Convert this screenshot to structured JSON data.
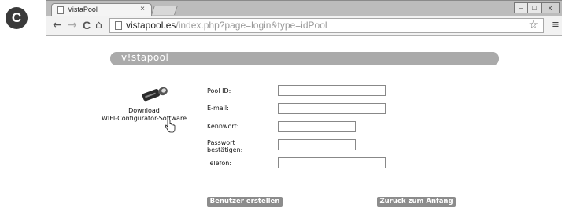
{
  "figure_label": "C",
  "browser": {
    "tab_title": "VistaPool",
    "tab_close": "×",
    "window_controls": [
      "–",
      "□",
      "x"
    ],
    "back": "←",
    "forward": "→",
    "reload": "C",
    "home": "⌂",
    "url_host": "vistapool.es",
    "url_path": "/index.php?page=login&type=idPool",
    "star": "☆",
    "menu": "≡"
  },
  "page": {
    "logo_text": "v!stapool",
    "download_label_line1": "Download",
    "download_label_line2": "WIFI-Configurator-Software",
    "form": {
      "pool_id_label": "Pool ID:",
      "email_label": "E-mail:",
      "password_label": "Kennwort:",
      "confirm_label_line1": "Passwort",
      "confirm_label_line2": "bestätigen:",
      "phone_label": "Telefon:",
      "pool_id_value": "",
      "email_value": "",
      "password_value": "",
      "confirm_value": "",
      "phone_value": ""
    },
    "create_button": "Benutzer erstellen",
    "back_button": "Zurück zum Anfang"
  },
  "colors": {
    "logo_bar": "#aaaaaa",
    "button": "#8c8c8c"
  }
}
